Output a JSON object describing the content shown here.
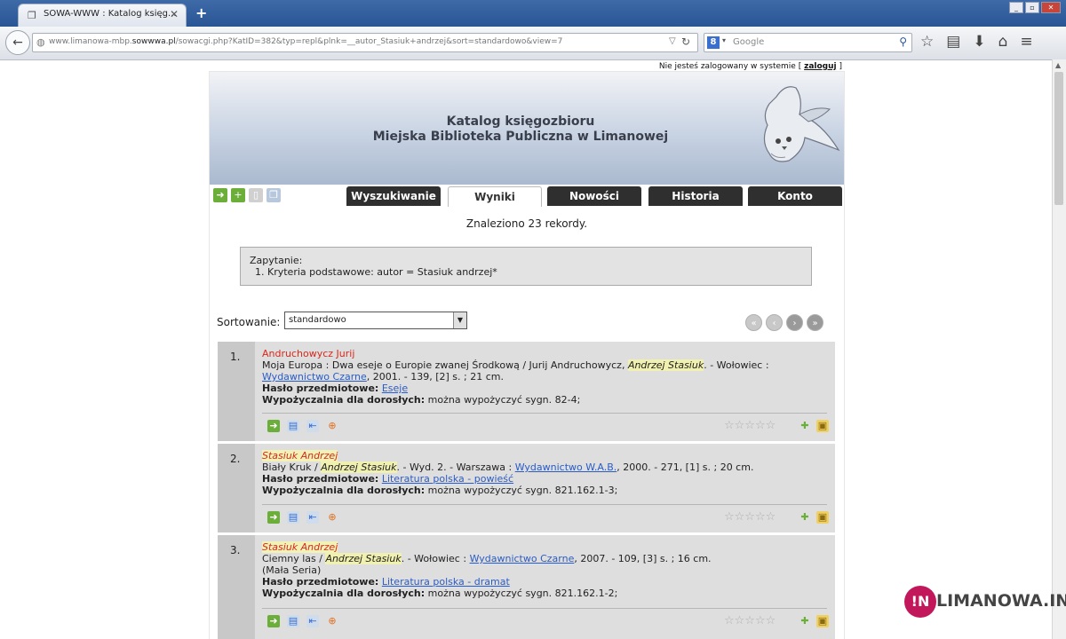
{
  "browser": {
    "tab_title": "SOWA-WWW : Katalog księg...",
    "url_prefix": "www.limanowa-mbp.",
    "url_domain": "sowwwa.pl",
    "url_rest": "/sowacgi.php?KatID=382&typ=repl&plnk=__autor_Stasiuk+andrzej&sort=standardowo&view=7",
    "search_placeholder": "Google"
  },
  "header": {
    "login_text": "Nie jesteś zalogowany w systemie [",
    "login_link": "zaloguj",
    "login_close": "]",
    "title_line1": "Katalog księgozbioru",
    "title_line2": "Miejska Biblioteka Publiczna w Limanowej"
  },
  "nav": {
    "tabs": [
      {
        "label": "Wyszukiwanie"
      },
      {
        "label": "Wyniki"
      },
      {
        "label": "Nowości"
      },
      {
        "label": "Historia"
      },
      {
        "label": "Konto"
      }
    ]
  },
  "results": {
    "found_text": "Znaleziono 23 rekordy.",
    "query_label": "Zapytanie:",
    "query_text": "1. Kryteria podstawowe: autor = Stasiuk andrzej*",
    "sort_label": "Sortowanie:",
    "sort_value": "standardowo"
  },
  "records": [
    {
      "num": "1.",
      "author": "Andruchowycz Jurij",
      "t1": "Moja Europa : Dwa eseje o Europie zwanej Środkową / Jurij Andruchowycz, ",
      "hl": "Andrzej Stasiuk",
      "t2": ". - Wołowiec :",
      "pub": "Wydawnictwo Czarne",
      "t3": ", 2001. - 139, [2] s. ; 21 cm.",
      "subj_label": "Hasło przedmiotowe:",
      "subj": "Eseje",
      "loan_label": "Wypożyczalnia dla dorosłych:",
      "loan": "można wypożyczyć sygn. 82-4;"
    },
    {
      "num": "2.",
      "author": "Stasiuk Andrzej",
      "t1": "Biały Kruk / ",
      "hl": "Andrzej Stasiuk",
      "t2": ". - Wyd. 2. - Warszawa : ",
      "pub": "Wydawnictwo W.A.B.",
      "t3": ", 2000. - 271, [1] s. ; 20 cm.",
      "subj_label": "Hasło przedmiotowe:",
      "subj": "Literatura polska - powieść",
      "loan_label": "Wypożyczalnia dla dorosłych:",
      "loan": "można wypożyczyć sygn. 821.162.1-3;"
    },
    {
      "num": "3.",
      "author": "Stasiuk Andrzej",
      "t1": "Ciemny las / ",
      "hl": "Andrzej Stasiuk",
      "t2": ". - Wołowiec : ",
      "pub": "Wydawnictwo Czarne",
      "t3": ", 2007. - 109, [3] s. ; 16 cm.",
      "series": "(Mała Seria)",
      "subj_label": "Hasło przedmiotowe:",
      "subj": "Literatura polska - dramat",
      "loan_label": "Wypożyczalnia dla dorosłych:",
      "loan": "można wypożyczyć sygn. 821.162.1-2;"
    }
  ],
  "watermark": {
    "badge": "!N",
    "text": "LIMANOWA.IN"
  },
  "colors": {
    "accent_red": "#d8281c",
    "link_blue": "#2a5cc6",
    "tab_dark": "#2f2f2f",
    "highlight": "#f0f0b0"
  },
  "icons": [
    "globe-icon",
    "reload-icon",
    "bookmark-star-icon",
    "reading-list-icon",
    "download-icon",
    "home-icon",
    "menu-icon",
    "owl-logo",
    "magnifier-icon",
    "cart-icon",
    "star-rating-icon"
  ]
}
